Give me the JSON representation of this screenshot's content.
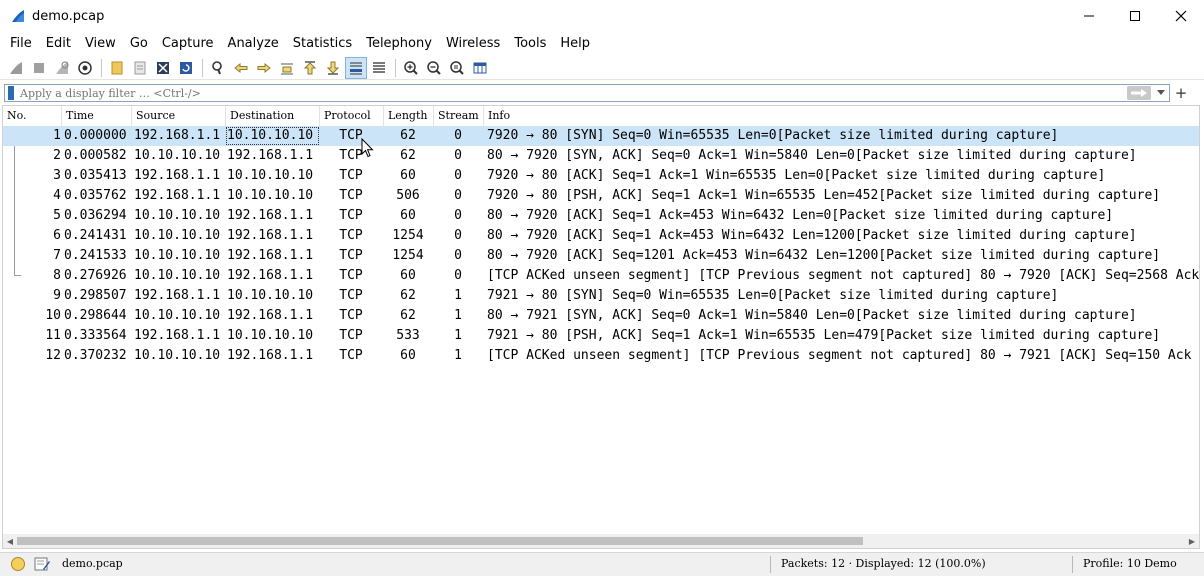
{
  "window": {
    "title": "demo.pcap",
    "controls": {
      "minimize": "—",
      "maximize": "☐",
      "close": "✕"
    }
  },
  "menu": [
    "File",
    "Edit",
    "View",
    "Go",
    "Capture",
    "Analyze",
    "Statistics",
    "Telephony",
    "Wireless",
    "Tools",
    "Help"
  ],
  "toolbar": {
    "buttons": [
      "start-capture-icon",
      "stop-capture-icon",
      "restart-capture-icon",
      "capture-options-icon",
      "open-file-icon",
      "save-file-icon",
      "close-file-icon",
      "reload-file-icon",
      "find-packet-icon",
      "go-back-icon",
      "go-forward-icon",
      "go-to-packet-icon",
      "go-first-packet-icon",
      "go-last-packet-icon",
      "auto-scroll-icon",
      "colorize-icon",
      "zoom-in-icon",
      "zoom-out-icon",
      "normal-size-icon",
      "resize-columns-icon"
    ],
    "active_button": "auto-scroll-icon"
  },
  "filter": {
    "placeholder": "Apply a display filter … <Ctrl-/>",
    "apply_icon": "arrow-right-icon",
    "add_button": "+"
  },
  "packet_list": {
    "columns": [
      "No.",
      "Time",
      "Source",
      "Destination",
      "Protocol",
      "Length",
      "Stream",
      "Info"
    ],
    "selected_row": 1,
    "rows": [
      {
        "no": "1",
        "time": "0.000000",
        "source": "192.168.1.1",
        "destination": "10.10.10.10",
        "protocol": "TCP",
        "length": "62",
        "stream": "0",
        "info": "7920 → 80 [SYN] Seq=0 Win=65535 Len=0[Packet size limited during capture]"
      },
      {
        "no": "2",
        "time": "0.000582",
        "source": "10.10.10.10",
        "destination": "192.168.1.1",
        "protocol": "TCP",
        "length": "62",
        "stream": "0",
        "info": "80 → 7920 [SYN, ACK] Seq=0 Ack=1 Win=5840 Len=0[Packet size limited during capture]"
      },
      {
        "no": "3",
        "time": "0.035413",
        "source": "192.168.1.1",
        "destination": "10.10.10.10",
        "protocol": "TCP",
        "length": "60",
        "stream": "0",
        "info": "7920 → 80 [ACK] Seq=1 Ack=1 Win=65535 Len=0[Packet size limited during capture]"
      },
      {
        "no": "4",
        "time": "0.035762",
        "source": "192.168.1.1",
        "destination": "10.10.10.10",
        "protocol": "TCP",
        "length": "506",
        "stream": "0",
        "info": "7920 → 80 [PSH, ACK] Seq=1 Ack=1 Win=65535 Len=452[Packet size limited during capture]"
      },
      {
        "no": "5",
        "time": "0.036294",
        "source": "10.10.10.10",
        "destination": "192.168.1.1",
        "protocol": "TCP",
        "length": "60",
        "stream": "0",
        "info": "80 → 7920 [ACK] Seq=1 Ack=453 Win=6432 Len=0[Packet size limited during capture]"
      },
      {
        "no": "6",
        "time": "0.241431",
        "source": "10.10.10.10",
        "destination": "192.168.1.1",
        "protocol": "TCP",
        "length": "1254",
        "stream": "0",
        "info": "80 → 7920 [ACK] Seq=1 Ack=453 Win=6432 Len=1200[Packet size limited during capture]"
      },
      {
        "no": "7",
        "time": "0.241533",
        "source": "10.10.10.10",
        "destination": "192.168.1.1",
        "protocol": "TCP",
        "length": "1254",
        "stream": "0",
        "info": "80 → 7920 [ACK] Seq=1201 Ack=453 Win=6432 Len=1200[Packet size limited during capture]"
      },
      {
        "no": "8",
        "time": "0.276926",
        "source": "10.10.10.10",
        "destination": "192.168.1.1",
        "protocol": "TCP",
        "length": "60",
        "stream": "0",
        "info": "[TCP ACKed unseen segment] [TCP Previous segment not captured] 80 → 7920 [ACK] Seq=2568 Ack"
      },
      {
        "no": "9",
        "time": "0.298507",
        "source": "192.168.1.1",
        "destination": "10.10.10.10",
        "protocol": "TCP",
        "length": "62",
        "stream": "1",
        "info": "7921 → 80 [SYN] Seq=0 Win=65535 Len=0[Packet size limited during capture]"
      },
      {
        "no": "10",
        "time": "0.298644",
        "source": "10.10.10.10",
        "destination": "192.168.1.1",
        "protocol": "TCP",
        "length": "62",
        "stream": "1",
        "info": "80 → 7921 [SYN, ACK] Seq=0 Ack=1 Win=5840 Len=0[Packet size limited during capture]"
      },
      {
        "no": "11",
        "time": "0.333564",
        "source": "192.168.1.1",
        "destination": "10.10.10.10",
        "protocol": "TCP",
        "length": "533",
        "stream": "1",
        "info": "7921 → 80 [PSH, ACK] Seq=1 Ack=1 Win=65535 Len=479[Packet size limited during capture]"
      },
      {
        "no": "12",
        "time": "0.370232",
        "source": "10.10.10.10",
        "destination": "192.168.1.1",
        "protocol": "TCP",
        "length": "60",
        "stream": "1",
        "info": "[TCP ACKed unseen segment] [TCP Previous segment not captured] 80 → 7921 [ACK] Seq=150 Ack"
      }
    ]
  },
  "statusbar": {
    "file": "demo.pcap",
    "packets": "Packets: 12 · Displayed: 12 (100.0%)",
    "profile": "Profile: 10 Demo"
  },
  "colors": {
    "selected_row": "#cce4f7",
    "status_led": "#f4cf5a",
    "accent": "#2e6ab0"
  }
}
